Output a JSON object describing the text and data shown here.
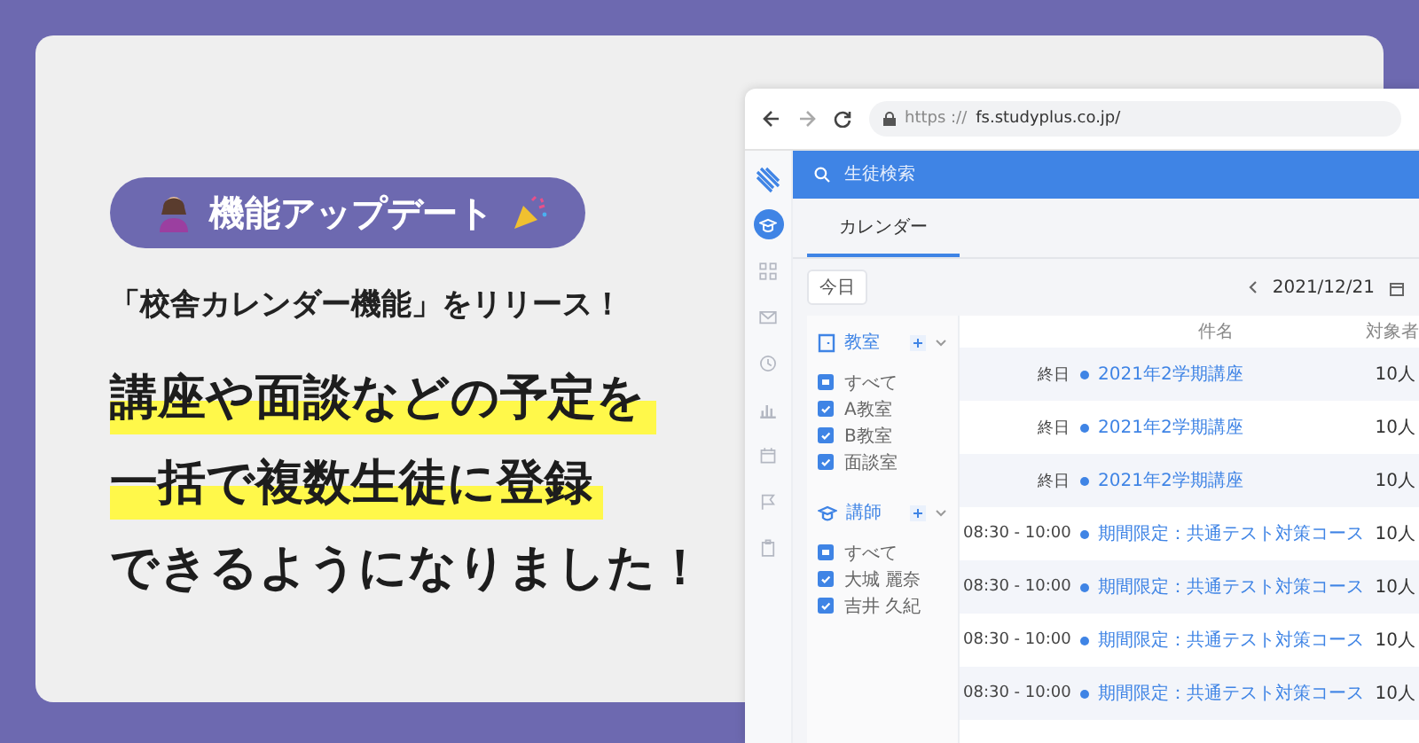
{
  "badge": {
    "label": "機能アップデート"
  },
  "subtitle": "「校舎カレンダー機能」をリリース！",
  "headline": [
    {
      "text": "講座や面談などの予定を",
      "highlighted": true
    },
    {
      "text": "一括で複数生徒に登録",
      "highlighted": true
    },
    {
      "text": "できるようになりました！",
      "highlighted": false
    }
  ],
  "browser": {
    "url_scheme": "https ://",
    "url_host": "fs.studyplus.co.jp/"
  },
  "app": {
    "search_placeholder": "生徒検索",
    "nav_items": [
      {
        "kind": "logo",
        "selected": false
      },
      {
        "kind": "cap",
        "selected": true
      },
      {
        "kind": "grid",
        "selected": false
      },
      {
        "kind": "mail",
        "selected": false
      },
      {
        "kind": "clock",
        "selected": false
      },
      {
        "kind": "chart",
        "selected": false
      },
      {
        "kind": "calendar",
        "selected": false
      },
      {
        "kind": "flag",
        "selected": false
      },
      {
        "kind": "clipboard",
        "selected": false
      }
    ],
    "tabs": [
      {
        "label": "カレンダー",
        "selected": true
      }
    ],
    "today_button": "今日",
    "date": "2021/12/21",
    "filters": [
      {
        "kind": "room",
        "title": "教室",
        "options": [
          {
            "label": "すべて",
            "checked": false,
            "indeterminate": true
          },
          {
            "label": "A教室",
            "checked": true,
            "indeterminate": false
          },
          {
            "label": "B教室",
            "checked": true,
            "indeterminate": false
          },
          {
            "label": "面談室",
            "checked": true,
            "indeterminate": false
          }
        ]
      },
      {
        "kind": "teacher",
        "title": "講師",
        "options": [
          {
            "label": "すべて",
            "checked": false,
            "indeterminate": true
          },
          {
            "label": "大城 麗奈",
            "checked": true,
            "indeterminate": false
          },
          {
            "label": "吉井 久紀",
            "checked": true,
            "indeterminate": false
          }
        ]
      }
    ],
    "table": {
      "columns": [
        "件名",
        "対象者"
      ],
      "rows": [
        {
          "time": "終日",
          "title": "2021年2学期講座",
          "count": "10人"
        },
        {
          "time": "終日",
          "title": "2021年2学期講座",
          "count": "10人"
        },
        {
          "time": "終日",
          "title": "2021年2学期講座",
          "count": "10人"
        },
        {
          "time": "08:30 - 10:00",
          "title": "期間限定：共通テスト対策コース",
          "count": "10人"
        },
        {
          "time": "08:30 - 10:00",
          "title": "期間限定：共通テスト対策コース",
          "count": "10人"
        },
        {
          "time": "08:30 - 10:00",
          "title": "期間限定：共通テスト対策コース",
          "count": "10人"
        },
        {
          "time": "08:30 - 10:00",
          "title": "期間限定：共通テスト対策コース",
          "count": "10人"
        }
      ]
    }
  }
}
